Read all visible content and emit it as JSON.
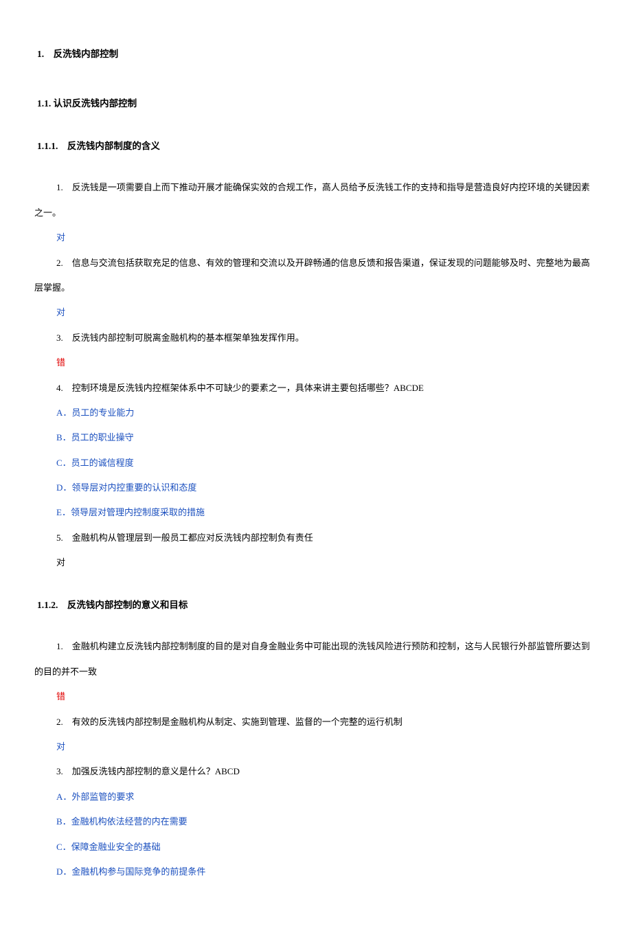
{
  "h1": "1.　反洗钱内部控制",
  "h2": "1.1. 认识反洗钱内部控制",
  "s111": {
    "title": "1.1.1.　反洗钱内部制度的含义",
    "q1": "1.　反洗钱是一项需要自上而下推动开展才能确保实效的合规工作，高人员给予反洗钱工作的支持和指导是营造良好内控环境的关键因素之一。",
    "a1": "对",
    "q2": "2.　信息与交流包括获取充足的信息、有效的管理和交流以及开辟畅通的信息反馈和报告渠道，保证发现的问题能够及时、完整地为最高层掌握。",
    "a2": "对",
    "q3": "3.　反洗钱内部控制可脱离金融机构的基本框架单独发挥作用。",
    "a3": "错",
    "q4": "4.　控制环境是反洗钱内控框架体系中不可缺少的要素之一，具体来讲主要包括哪些？ABCDE",
    "q4_opts": {
      "A": "A．员工的专业能力",
      "B": "B．员工的职业操守",
      "C": "C．员工的诚信程度",
      "D": "D．领导层对内控重要的认识和态度",
      "E": "E．领导层对管理内控制度采取的措施"
    },
    "q5": "5.　金融机构从管理层到一般员工都应对反洗钱内部控制负有责任",
    "a5": "对"
  },
  "s112": {
    "title": "1.1.2.　反洗钱内部控制的意义和目标",
    "q1": "1.　金融机构建立反洗钱内部控制制度的目的是对自身金融业务中可能出现的洗钱风险进行预防和控制，这与人民银行外部监管所要达到的目的并不一致",
    "a1": "错",
    "q2": "2.　有效的反洗钱内部控制是金融机构从制定、实施到管理、监督的一个完整的运行机制",
    "a2": "对",
    "q3": "3.　加强反洗钱内部控制的意义是什么？ABCD",
    "q3_opts": {
      "A": "A．外部监管的要求",
      "B": "B．金融机构依法经营的内在需要",
      "C": "C．保障金融业安全的基础",
      "D": "D．金融机构参与国际竞争的前提条件"
    }
  }
}
